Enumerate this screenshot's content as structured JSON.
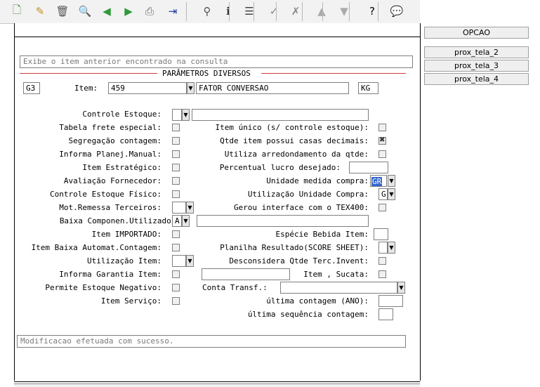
{
  "toolbar": {
    "buttons": [
      {
        "name": "new-icon",
        "glyph": "🗋",
        "color": "#4a8a2a"
      },
      {
        "name": "edit-icon",
        "glyph": "✎",
        "color": "#c09020"
      },
      {
        "name": "delete-icon",
        "glyph": "🗑",
        "color": "#555555"
      },
      {
        "name": "search-icon",
        "glyph": "🔍",
        "color": "#2050a0"
      },
      {
        "name": "previous-icon",
        "glyph": "◀",
        "color": "#2f9a3a"
      },
      {
        "name": "next-icon",
        "glyph": "▶",
        "color": "#2f9a3a"
      },
      {
        "name": "print-icon",
        "glyph": "⎙",
        "color": "#666666"
      },
      {
        "name": "exit-icon",
        "glyph": "⇥",
        "color": "#2040a0"
      },
      {
        "name": "binoculars-icon",
        "glyph": "⚲",
        "color": "#555555"
      },
      {
        "name": "info-icon",
        "glyph": "ℹ",
        "color": "#333333"
      },
      {
        "name": "list-icon",
        "glyph": "☰",
        "color": "#444444"
      },
      {
        "name": "confirm-icon",
        "glyph": "✓",
        "color": "#888888"
      },
      {
        "name": "cancel-icon",
        "glyph": "✗",
        "color": "#888888"
      },
      {
        "name": "up-icon",
        "glyph": "▲",
        "color": "#aaaaaa"
      },
      {
        "name": "down-icon",
        "glyph": "▼",
        "color": "#aaaaaa"
      },
      {
        "name": "help-icon",
        "glyph": "?",
        "color": "#000000"
      },
      {
        "name": "chat-icon",
        "glyph": "💬",
        "color": "#333333"
      }
    ]
  },
  "side_buttons": {
    "opcao": "OPCAO",
    "prox_tela_2": "prox_tela_2",
    "prox_tela_3": "prox_tela_3",
    "prox_tela_4": "prox_tela_4"
  },
  "top_message": "Exibe o item anterior encontrado na consulta",
  "section_title": "PARÂMETROS DIVERSOS",
  "header": {
    "company": "G3",
    "item_label": "Item:",
    "item_value": "459",
    "item_description": "FATOR CONVERSAO",
    "unit": "KG"
  },
  "left_fields": {
    "controle_estoque": "Controle Estoque:",
    "tabela_frete": "Tabela frete especial:",
    "segregacao": "Segregação contagem:",
    "informa_planej": "Informa Planej.Manual:",
    "item_estrategico": "Item Estratégico:",
    "avaliacao": "Avaliação Fornecedor:",
    "controle_fisico": "Controle Estoque Físico:",
    "mot_remessa": "Mot.Remessa Terceiros:",
    "baixa_componen": "Baixa Componen.Utilizados:",
    "baixa_componen_value": "A",
    "item_importado": "Item IMPORTADO:",
    "item_baixa_automat": "Item Baixa Automat.Contagem:",
    "utilizacao_item": "Utilização Item:",
    "informa_garantia": "Informa Garantia Item:",
    "permite_negativo": "Permite Estoque Negativo:",
    "item_servico": "Item Serviço:"
  },
  "right_fields": {
    "item_unico": "Item único (s/ controle estoque):",
    "qtde_casas": "Qtde item possui casas decimais:",
    "utiliza_arredondamento": "Utiliza arredondamento da qtde:",
    "percentual_lucro": "Percentual lucro desejado:",
    "unidade_compra": "Unidade medida compra:",
    "unidade_compra_value": "GR",
    "utilizacao_unidade": "Utilização Unidade Compra:",
    "utilizacao_unidade_value": "G",
    "gerou_interface": "Gerou interface com o TEX400:",
    "especie_bebida": "Espécie Bebida Item:",
    "planilha_resultado": "Planilha Resultado(SCORE SHEET):",
    "desconsidera": "Desconsidera Qtde Terc.Invent:",
    "item_sucata": "Item , Sucata:",
    "conta_transf": "Conta Transf.:",
    "ultima_contagem": "última contagem (ANO):",
    "ultima_sequencia": "última sequência contagem:"
  },
  "checkbox_states": {
    "qtde_casas_checked": true
  },
  "status_message": "Modificacao efetuada com sucesso."
}
